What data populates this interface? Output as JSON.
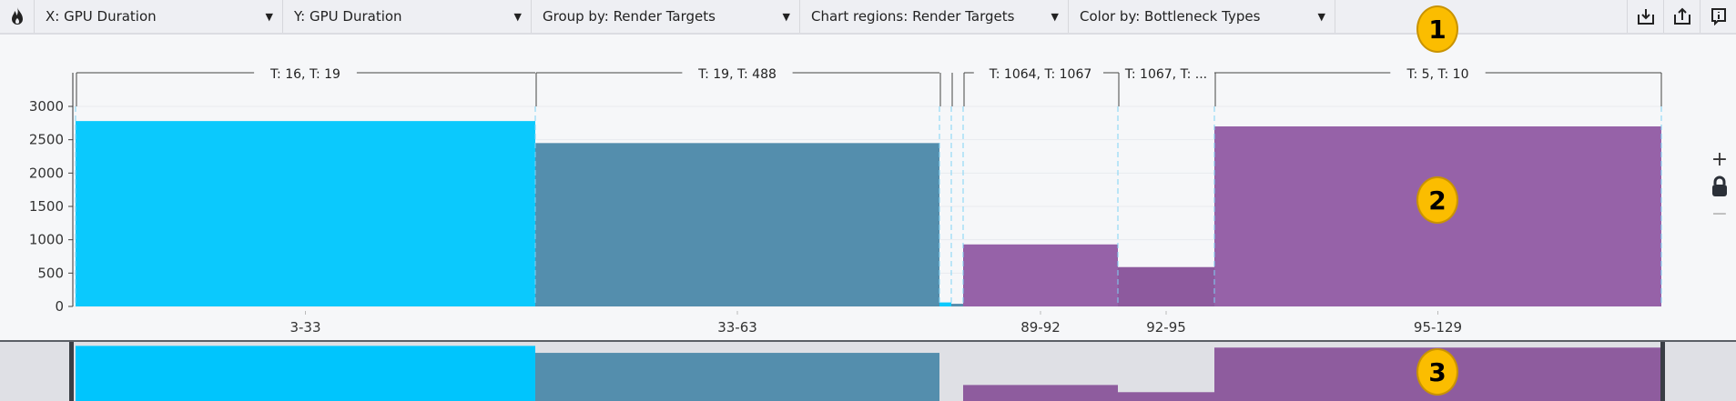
{
  "toolbar": {
    "flame_icon": "flame-icon",
    "dropdowns": [
      {
        "label": "X: GPU Duration"
      },
      {
        "label": "Y: GPU Duration"
      },
      {
        "label": "Group by: Render Targets"
      },
      {
        "label": "Chart regions: Render Targets"
      },
      {
        "label": "Color by: Bottleneck Types"
      }
    ],
    "actions": [
      "download-icon",
      "share-icon",
      "info-icon"
    ]
  },
  "badges": [
    "1",
    "2",
    "3"
  ],
  "side_controls": {
    "zoom_in": "+",
    "zoom_out": "−"
  },
  "colors": {
    "cyan": "#0bc9fd",
    "steel": "#548ead",
    "purple": "#9662a8",
    "purple_dark": "#8d5a9e",
    "overview_cyan": "#00c5fd",
    "overview_purple": "#8e5c9e"
  },
  "chart_data": {
    "type": "bar",
    "ylim": [
      0,
      3000
    ],
    "yticks": [
      "0",
      "500",
      "1000",
      "1500",
      "2000",
      "2500",
      "3000"
    ],
    "bars": [
      {
        "label": "3-33",
        "value": 2780,
        "color": "cyan"
      },
      {
        "label": "33-63",
        "value": 2450,
        "color": "steel"
      },
      {
        "label": "",
        "value": 60,
        "color": "cyan"
      },
      {
        "label": "",
        "value": 40,
        "color": "steel"
      },
      {
        "label": "89-92",
        "value": 930,
        "color": "purple"
      },
      {
        "label": "92-95",
        "value": 590,
        "color": "purple_dark"
      },
      {
        "label": "95-129",
        "value": 2700,
        "color": "purple"
      }
    ],
    "regions": [
      "T: 16, T: 19",
      "T: 19, T: 488",
      "",
      "",
      "T: 1064, T: 1067",
      "T: 1067, T: ...",
      "T: 5, T: 10"
    ]
  }
}
